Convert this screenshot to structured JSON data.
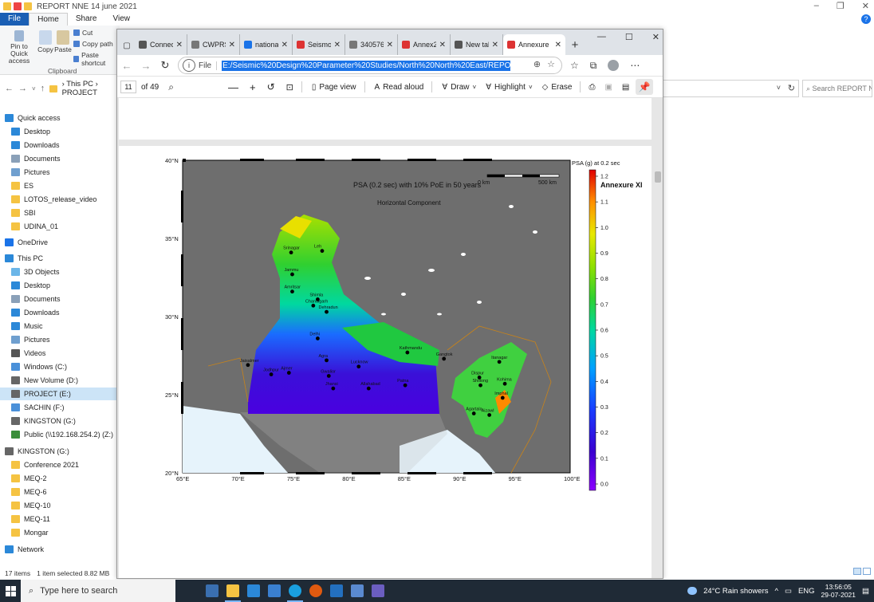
{
  "explorer": {
    "title": "REPORT NNE 14 june 2021",
    "ribbon_tabs": [
      "File",
      "Home",
      "Share",
      "View"
    ],
    "ribbon": {
      "pin_label": "Pin to Quick access",
      "copy_label": "Copy",
      "paste_label": "Paste",
      "cut_label": "Cut",
      "copy_path_label": "Copy path",
      "paste_shortcut_label": "Paste shortcut",
      "group_label": "Clipboard"
    },
    "breadcrumb": [
      "This PC",
      "PROJECT"
    ],
    "search_placeholder": "Search REPORT N...",
    "nav": [
      {
        "label": "Quick access",
        "icon": "star-icon",
        "color": "#2b88d8"
      },
      {
        "label": "Desktop",
        "icon": "desktop-icon",
        "color": "#2b88d8"
      },
      {
        "label": "Downloads",
        "icon": "download-icon",
        "color": "#2b88d8"
      },
      {
        "label": "Documents",
        "icon": "documents-icon",
        "color": "#8aa0b8"
      },
      {
        "label": "Pictures",
        "icon": "pictures-icon",
        "color": "#6f9fcf"
      },
      {
        "label": "ES",
        "icon": "folder-icon",
        "color": "#f5c342"
      },
      {
        "label": "LOTOS_release_video",
        "icon": "folder-icon",
        "color": "#f5c342"
      },
      {
        "label": "SBI",
        "icon": "folder-icon",
        "color": "#f5c342"
      },
      {
        "label": "UDINA_01",
        "icon": "folder-icon",
        "color": "#f5c342"
      },
      {
        "label": "OneDrive",
        "icon": "cloud-icon",
        "color": "#1a73e8"
      },
      {
        "label": "This PC",
        "icon": "pc-icon",
        "color": "#2b88d8"
      },
      {
        "label": "3D Objects",
        "icon": "cube-icon",
        "color": "#6bb6e8"
      },
      {
        "label": "Desktop",
        "icon": "desktop-icon",
        "color": "#2b88d8"
      },
      {
        "label": "Documents",
        "icon": "documents-icon",
        "color": "#8aa0b8"
      },
      {
        "label": "Downloads",
        "icon": "download-icon",
        "color": "#2b88d8"
      },
      {
        "label": "Music",
        "icon": "music-icon",
        "color": "#2b88d8"
      },
      {
        "label": "Pictures",
        "icon": "pictures-icon",
        "color": "#6f9fcf"
      },
      {
        "label": "Videos",
        "icon": "video-icon",
        "color": "#555"
      },
      {
        "label": "Windows (C:)",
        "icon": "drive-icon",
        "color": "#4a90d9"
      },
      {
        "label": "New Volume (D:)",
        "icon": "drive-icon",
        "color": "#666"
      },
      {
        "label": "PROJECT (E:)",
        "icon": "drive-icon",
        "color": "#666",
        "selected": true
      },
      {
        "label": "SACHIN (F:)",
        "icon": "usb-icon",
        "color": "#4a90d9"
      },
      {
        "label": "KINGSTON (G:)",
        "icon": "drive-icon",
        "color": "#666"
      },
      {
        "label": "Public (\\\\192.168.254.2) (Z:)",
        "icon": "network-drive-icon",
        "color": "#3a8e3a"
      },
      {
        "label": "KINGSTON (G:)",
        "icon": "drive-icon",
        "color": "#666"
      },
      {
        "label": "Conference 2021",
        "icon": "folder-icon",
        "color": "#f5c342"
      },
      {
        "label": "MEQ-2",
        "icon": "folder-icon",
        "color": "#f5c342"
      },
      {
        "label": "MEQ-6",
        "icon": "folder-icon",
        "color": "#f5c342"
      },
      {
        "label": "MEQ-10",
        "icon": "folder-icon",
        "color": "#f5c342"
      },
      {
        "label": "MEQ-11",
        "icon": "folder-icon",
        "color": "#f5c342"
      },
      {
        "label": "Mongar",
        "icon": "folder-icon",
        "color": "#f5c342"
      },
      {
        "label": "Network",
        "icon": "network-icon",
        "color": "#2b88d8"
      }
    ],
    "status": {
      "items": "17 items",
      "selected": "1 item selected  8.82 MB"
    }
  },
  "browser": {
    "tabs": [
      {
        "label": "Connect",
        "color": "#555"
      },
      {
        "label": "CWPRS",
        "color": "#777"
      },
      {
        "label": "nationalit",
        "color": "#1a73e8"
      },
      {
        "label": "Seismolo",
        "color": "#d33"
      },
      {
        "label": "34057614",
        "color": "#777"
      },
      {
        "label": "Annex26",
        "color": "#d33"
      },
      {
        "label": "New tab",
        "color": "#555"
      },
      {
        "label": "Annexure",
        "color": "#d33",
        "active": true
      }
    ],
    "omnibox": {
      "scheme_label": "File",
      "url": "E:/Seismic%20Design%20Parameter%20Studies/North%20North%20East/REPORT%20NNE%2014%20june%202021"
    },
    "pdf_toolbar": {
      "page": "11",
      "page_count": "of 49",
      "page_view": "Page view",
      "read_aloud": "Read aloud",
      "draw": "Draw",
      "highlight": "Highlight",
      "erase": "Erase"
    }
  },
  "map": {
    "title": "PSA (0.2 sec) with 10% PoE in 50  years",
    "subtitle": "Horizontal Component",
    "scale_start": "0 km",
    "scale_end": "500 km",
    "colorbar_title": "PSA (g) at 0.2 sec",
    "annexure": "Annexure XI",
    "lat_labels": [
      "40°N",
      "35°N",
      "30°N",
      "25°N",
      "20°N"
    ],
    "lon_labels": [
      "65°E",
      "70°E",
      "75°E",
      "80°E",
      "85°E",
      "90°E",
      "95°E",
      "100°E"
    ],
    "colorbar_ticks": [
      "1.2",
      "1.1",
      "1.0",
      "0.9",
      "0.8",
      "0.7",
      "0.6",
      "0.5",
      "0.4",
      "0.3",
      "0.2",
      "0.1",
      "0.0"
    ],
    "cities": [
      {
        "name": "Srinagar",
        "lon": 74.8,
        "lat": 34.1
      },
      {
        "name": "Leh",
        "lon": 77.6,
        "lat": 34.2
      },
      {
        "name": "Jammu",
        "lon": 74.9,
        "lat": 32.7
      },
      {
        "name": "Amritsar",
        "lon": 74.9,
        "lat": 31.6
      },
      {
        "name": "Shimla",
        "lon": 77.2,
        "lat": 31.1
      },
      {
        "name": "Chandigarh",
        "lon": 76.8,
        "lat": 30.7
      },
      {
        "name": "Dehradun",
        "lon": 78.0,
        "lat": 30.3
      },
      {
        "name": "Delhi",
        "lon": 77.2,
        "lat": 28.6
      },
      {
        "name": "Jaisalmer",
        "lon": 70.9,
        "lat": 26.9
      },
      {
        "name": "Jodhpur",
        "lon": 73.0,
        "lat": 26.3
      },
      {
        "name": "Ajmer",
        "lon": 74.6,
        "lat": 26.4
      },
      {
        "name": "Agra",
        "lon": 78.0,
        "lat": 27.2
      },
      {
        "name": "Gwalior",
        "lon": 78.2,
        "lat": 26.2
      },
      {
        "name": "Jhansi",
        "lon": 78.6,
        "lat": 25.4
      },
      {
        "name": "Lucknow",
        "lon": 80.9,
        "lat": 26.8
      },
      {
        "name": "Allahabad",
        "lon": 81.8,
        "lat": 25.4
      },
      {
        "name": "Patna",
        "lon": 85.1,
        "lat": 25.6
      },
      {
        "name": "Kathmandu",
        "lon": 85.3,
        "lat": 27.7
      },
      {
        "name": "Gangtok",
        "lon": 88.6,
        "lat": 27.3
      },
      {
        "name": "Itanagar",
        "lon": 93.6,
        "lat": 27.1
      },
      {
        "name": "Dispur",
        "lon": 91.8,
        "lat": 26.1
      },
      {
        "name": "Shillong",
        "lon": 91.9,
        "lat": 25.6
      },
      {
        "name": "Kohima",
        "lon": 94.1,
        "lat": 25.7
      },
      {
        "name": "Imphal",
        "lon": 93.9,
        "lat": 24.8
      },
      {
        "name": "Agartala",
        "lon": 91.3,
        "lat": 23.8
      },
      {
        "name": "Aizawl",
        "lon": 92.7,
        "lat": 23.7
      }
    ]
  },
  "taskbar": {
    "search_placeholder": "Type here to search",
    "weather": "24°C  Rain showers",
    "lang": "ENG",
    "time": "13:56:05",
    "date": "29-07-2021"
  }
}
